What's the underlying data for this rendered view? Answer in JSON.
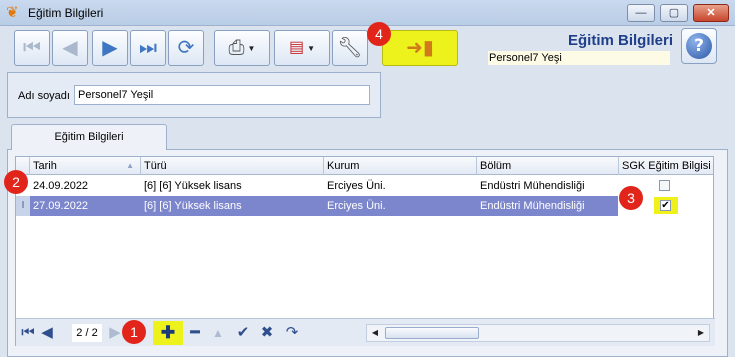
{
  "window": {
    "title": "Eğitim Bilgileri"
  },
  "header": {
    "title": "Eğitim Bilgileri",
    "person": "Personel7 Yeşi"
  },
  "form": {
    "name_label": "Adı soyadı",
    "name_value": "Personel7 Yeşil"
  },
  "tabs": [
    {
      "label": "Eğitim Bilgileri"
    }
  ],
  "grid": {
    "columns": [
      "Tarih",
      "Türü",
      "Kurum",
      "Bölüm",
      "SGK Eğitim Bilgisi"
    ],
    "rows": [
      {
        "tarih": "24.09.2022",
        "turu": "[6] [6] Yüksek lisans",
        "kurum": "Erciyes Üni.",
        "bolum": "Endüstri Mühendisliği",
        "sgk": false
      },
      {
        "tarih": "27.09.2022",
        "turu": "[6] [6] Yüksek lisans",
        "kurum": "Erciyes Üni.",
        "bolum": "Endüstri Mühendisliği",
        "sgk": true
      }
    ],
    "selected_row_indicator": "I"
  },
  "navigator": {
    "page": "2 / 2"
  },
  "badges": [
    "1",
    "2",
    "3",
    "4"
  ],
  "colors": {
    "highlight": "#eef21c",
    "selection": "#7c86cc",
    "badge": "#e1251b",
    "title_blue": "#1f3f8a"
  },
  "icons": {
    "first": "first-record-icon",
    "prev": "previous-record-icon",
    "next": "next-record-icon",
    "last": "last-record-icon",
    "refresh": "refresh-icon",
    "print": "printer-icon",
    "export": "pdf-export-icon",
    "settings": "wrench-icon",
    "exit": "exit-door-icon",
    "help": "help-icon"
  }
}
